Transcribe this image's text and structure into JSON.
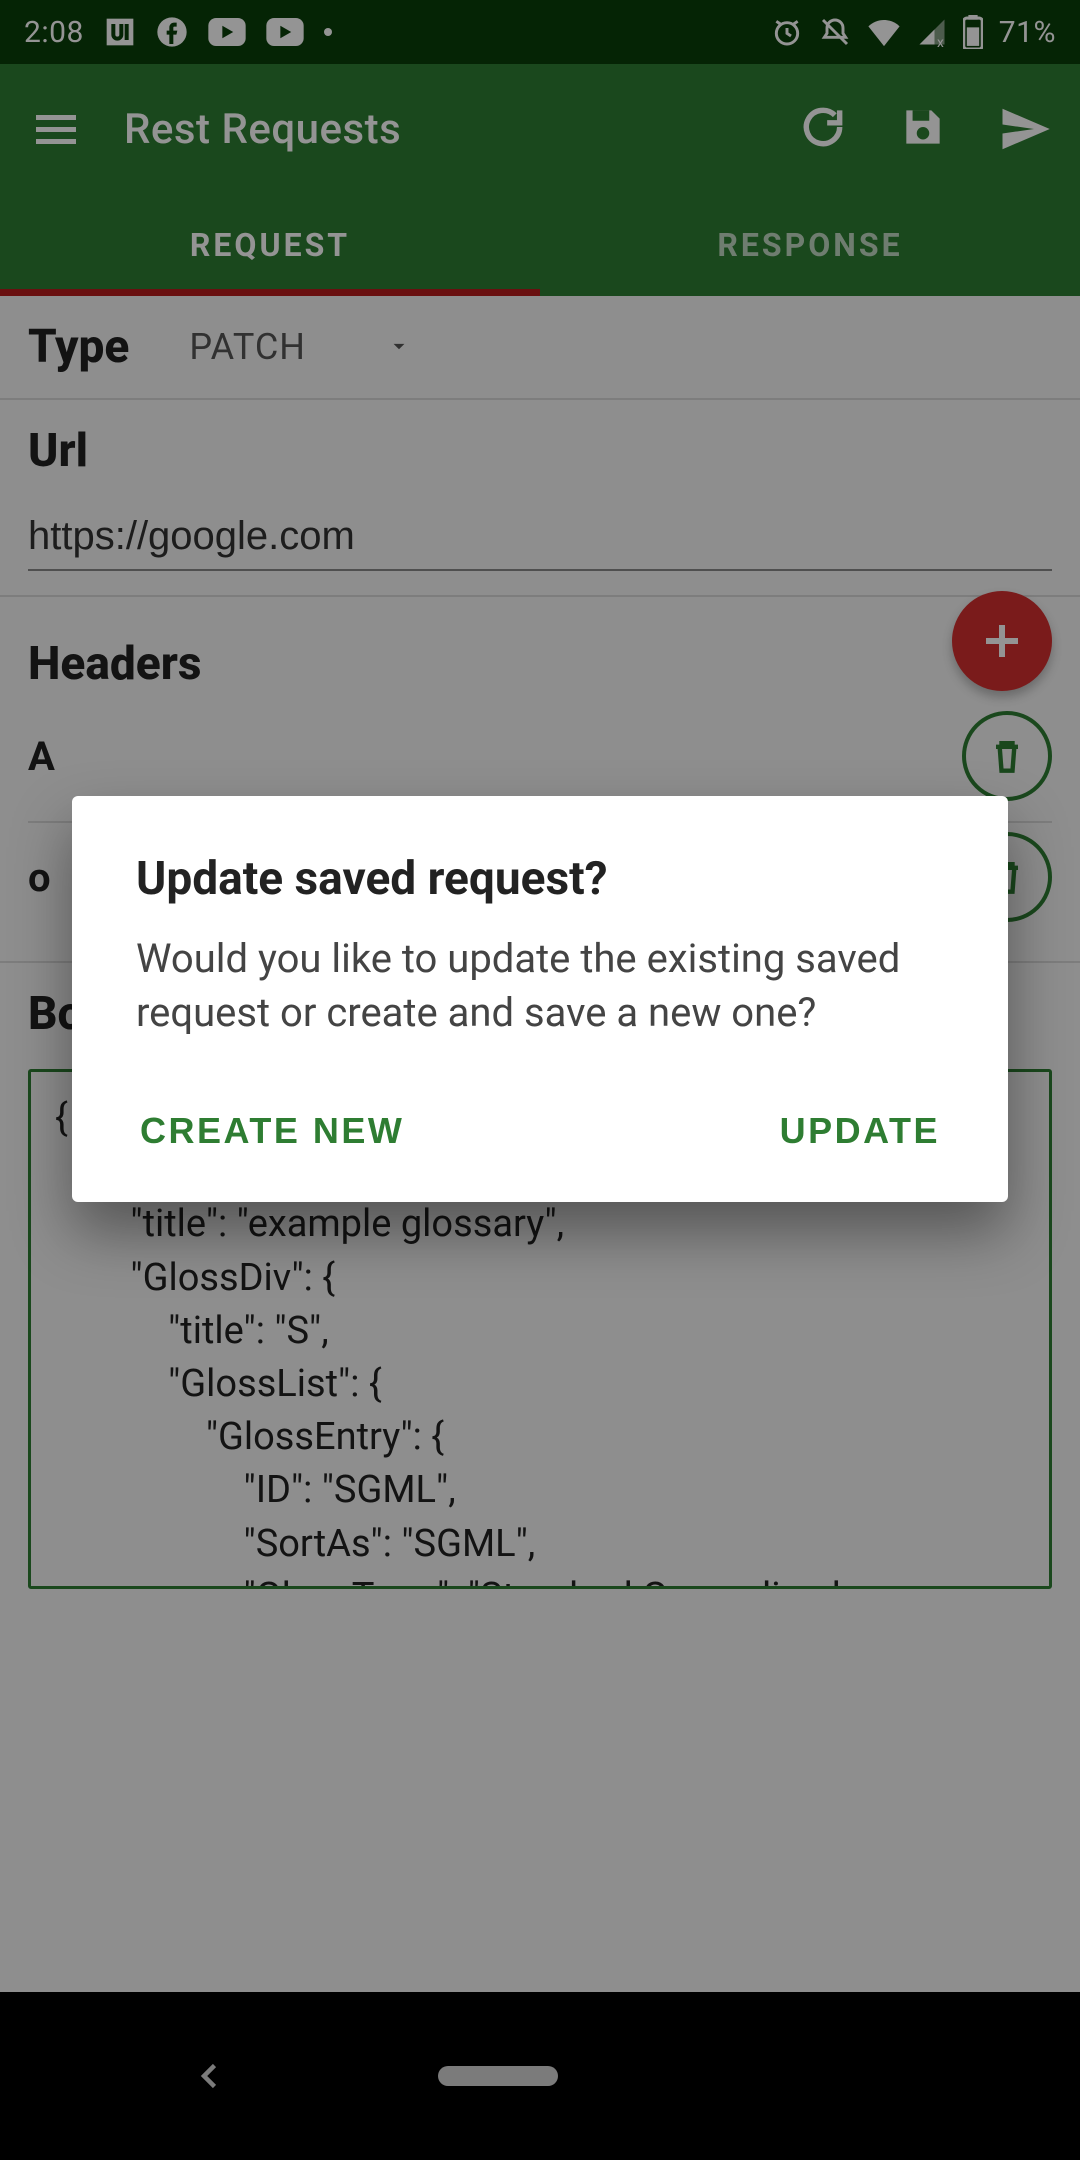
{
  "status": {
    "time": "2:08",
    "battery": "71%"
  },
  "appbar": {
    "title": "Rest Requests"
  },
  "tabs": {
    "request": "REQUEST",
    "response": "RESPONSE"
  },
  "type": {
    "label": "Type",
    "value": "PATCH"
  },
  "url": {
    "label": "Url",
    "value": "https://google.com"
  },
  "headers": {
    "label": "Headers",
    "row1_visible": "A",
    "row2_visible": "o"
  },
  "body": {
    "label": "Body",
    "content": "{\n    \"glossary\": {\n        \"title\": \"example glossary\",\n        \"GlossDiv\": {\n            \"title\": \"S\",\n            \"GlossList\": {\n                \"GlossEntry\": {\n                    \"ID\": \"SGML\",\n                    \"SortAs\": \"SGML\",\n                    \"GlossTerm\": \"Standard Generalized"
  },
  "dialog": {
    "title": "Update saved request?",
    "message": "Would you like to update the existing saved request or create and save a new one?",
    "create": "CREATE NEW",
    "update": "UPDATE"
  }
}
